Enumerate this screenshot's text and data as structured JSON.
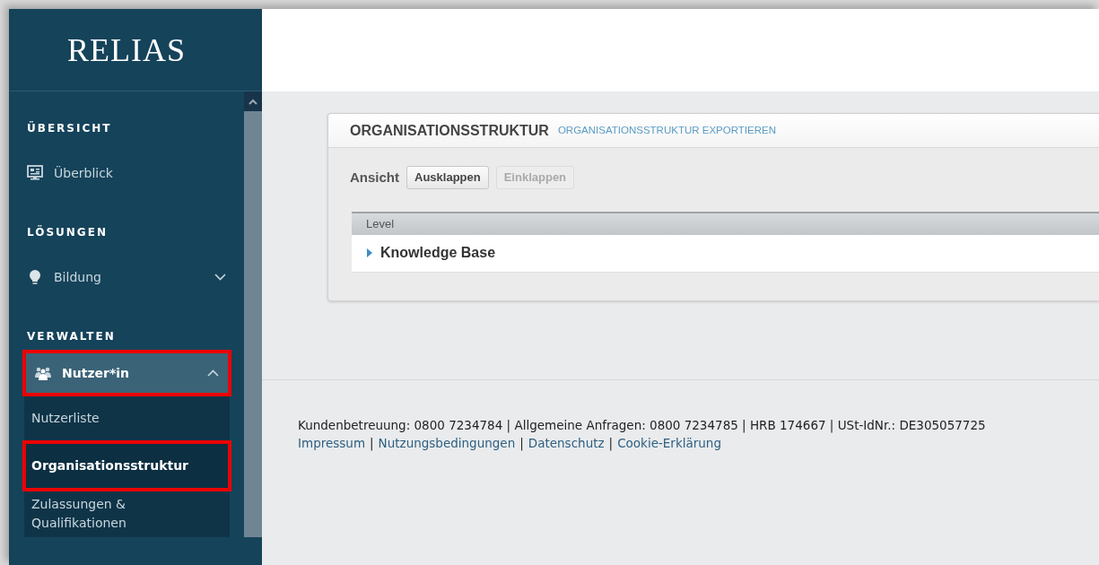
{
  "sidebar": {
    "logo": "RELIAS",
    "sections": [
      {
        "heading": "ÜBERSICHT",
        "items": [
          {
            "label": "Überblick",
            "kind": "monitor",
            "annotated": false
          }
        ]
      },
      {
        "heading": "LÖSUNGEN",
        "items": [
          {
            "label": "Bildung",
            "kind": "bulb",
            "expanded": false,
            "annotated": false
          }
        ]
      },
      {
        "heading": "VERWALTEN",
        "items": [
          {
            "label": "Nutzer*in",
            "kind": "people",
            "expanded": true,
            "annotated": true,
            "children": [
              {
                "label": "Nutzerliste",
                "selected": false,
                "annotated": false
              },
              {
                "label": "Organisationsstruktur",
                "selected": true,
                "annotated": true
              },
              {
                "label": "Zulassungen & Qualifikationen",
                "selected": false,
                "annotated": false
              }
            ]
          }
        ]
      }
    ]
  },
  "panel": {
    "title": "ORGANISATIONSSTRUKTUR",
    "export_link": "ORGANISATIONSSTRUKTUR EXPORTIEREN",
    "view_label": "Ansicht",
    "buttons": [
      {
        "label": "Ausklappen",
        "disabled": false
      },
      {
        "label": "Einklappen",
        "disabled": true
      }
    ],
    "table": {
      "columns": [
        "Level"
      ],
      "rows": [
        {
          "label": "Knowledge Base",
          "expanded": false
        }
      ]
    }
  },
  "footer": {
    "info": "Kundenbetreuung: 0800 7234784 | Allgemeine Anfragen: 0800 7234785 | HRB 174667 | USt-IdNr.: DE305057725",
    "separator": "|",
    "links": [
      "Impressum",
      "Nutzungsbedingungen",
      "Datenschutz",
      "Cookie-Erklärung"
    ]
  }
}
